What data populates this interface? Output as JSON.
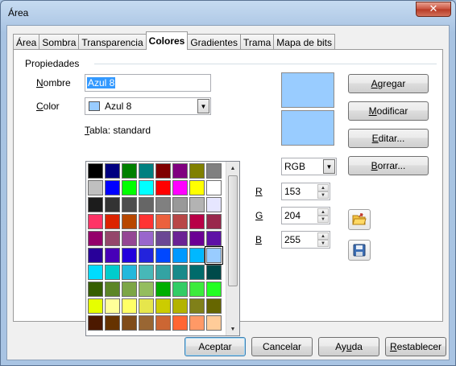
{
  "window": {
    "title": "Área",
    "close_label": "✕"
  },
  "tabs": [
    {
      "label": "Área",
      "active": false
    },
    {
      "label": "Sombra",
      "active": false
    },
    {
      "label": "Transparencia",
      "active": false
    },
    {
      "label": "Colores",
      "active": true
    },
    {
      "label": "Gradientes",
      "active": false
    },
    {
      "label": "Trama",
      "active": false
    },
    {
      "label": "Mapa de bits",
      "active": false
    }
  ],
  "properties": {
    "group_label": "Propiedades",
    "name_label_u": "N",
    "name_label_rest": "ombre",
    "name_value": "Azul 8",
    "color_label_u": "C",
    "color_label_rest": "olor",
    "color_value": "Azul 8",
    "color_swatch": "#99ccff",
    "table_label_u": "T",
    "table_label_rest": "abla: standard"
  },
  "palette": {
    "colors": [
      "#000000",
      "#000080",
      "#008000",
      "#008080",
      "#800000",
      "#800080",
      "#808000",
      "#808080",
      "#c0c0c0",
      "#0000ff",
      "#00ff00",
      "#00ffff",
      "#ff0000",
      "#ff00ff",
      "#ffff00",
      "#ffffff",
      "#1c1c1c",
      "#333333",
      "#4d4d4d",
      "#666666",
      "#808080",
      "#999999",
      "#b3b3b3",
      "#e6e6ff",
      "#ff3366",
      "#dc2300",
      "#b84700",
      "#ff3333",
      "#eb613d",
      "#b84747",
      "#b80047",
      "#99284c",
      "#94006b",
      "#94476b",
      "#944794",
      "#9966cc",
      "#6b4794",
      "#6b2394",
      "#6b0094",
      "#5e11a6",
      "#280099",
      "#4700b8",
      "#2300dc",
      "#2323dc",
      "#0047ff",
      "#0099ff",
      "#00b8ff",
      "#99ccff",
      "#00dcff",
      "#00cccc",
      "#23b8dc",
      "#47b8b8",
      "#33a3a3",
      "#198a8a",
      "#006b6b",
      "#004a4a",
      "#355e00",
      "#5c8526",
      "#7da647",
      "#94bd5e",
      "#00ae00",
      "#33cc66",
      "#3deb3d",
      "#23ff23",
      "#e6ff00",
      "#ffff99",
      "#ffff66",
      "#e6e64c",
      "#cccc00",
      "#b3b300",
      "#808019",
      "#666600",
      "#4c1900",
      "#663300",
      "#804c19",
      "#996633",
      "#cc6633",
      "#ff6633",
      "#ff9966",
      "#ffcc99"
    ],
    "selected_index": 47
  },
  "preview": {
    "top_color": "#99ccff",
    "bottom_color": "#99ccff"
  },
  "color_model": {
    "value": "RGB"
  },
  "rgb": [
    {
      "label": "R",
      "value": "153"
    },
    {
      "label": "G",
      "value": "204"
    },
    {
      "label": "B",
      "value": "255"
    }
  ],
  "side_buttons": {
    "add_u": "A",
    "add_rest": "gregar",
    "modify_u": "M",
    "modify_rest": "odificar",
    "edit_u": "E",
    "edit_rest": "ditar...",
    "delete_u": "B",
    "delete_rest": "orrar..."
  },
  "bottom_buttons": {
    "ok": "Aceptar",
    "cancel": "Cancelar",
    "help_pre": "Ay",
    "help_u": "u",
    "help_post": "da",
    "reset_u": "R",
    "reset_rest": "establecer"
  }
}
